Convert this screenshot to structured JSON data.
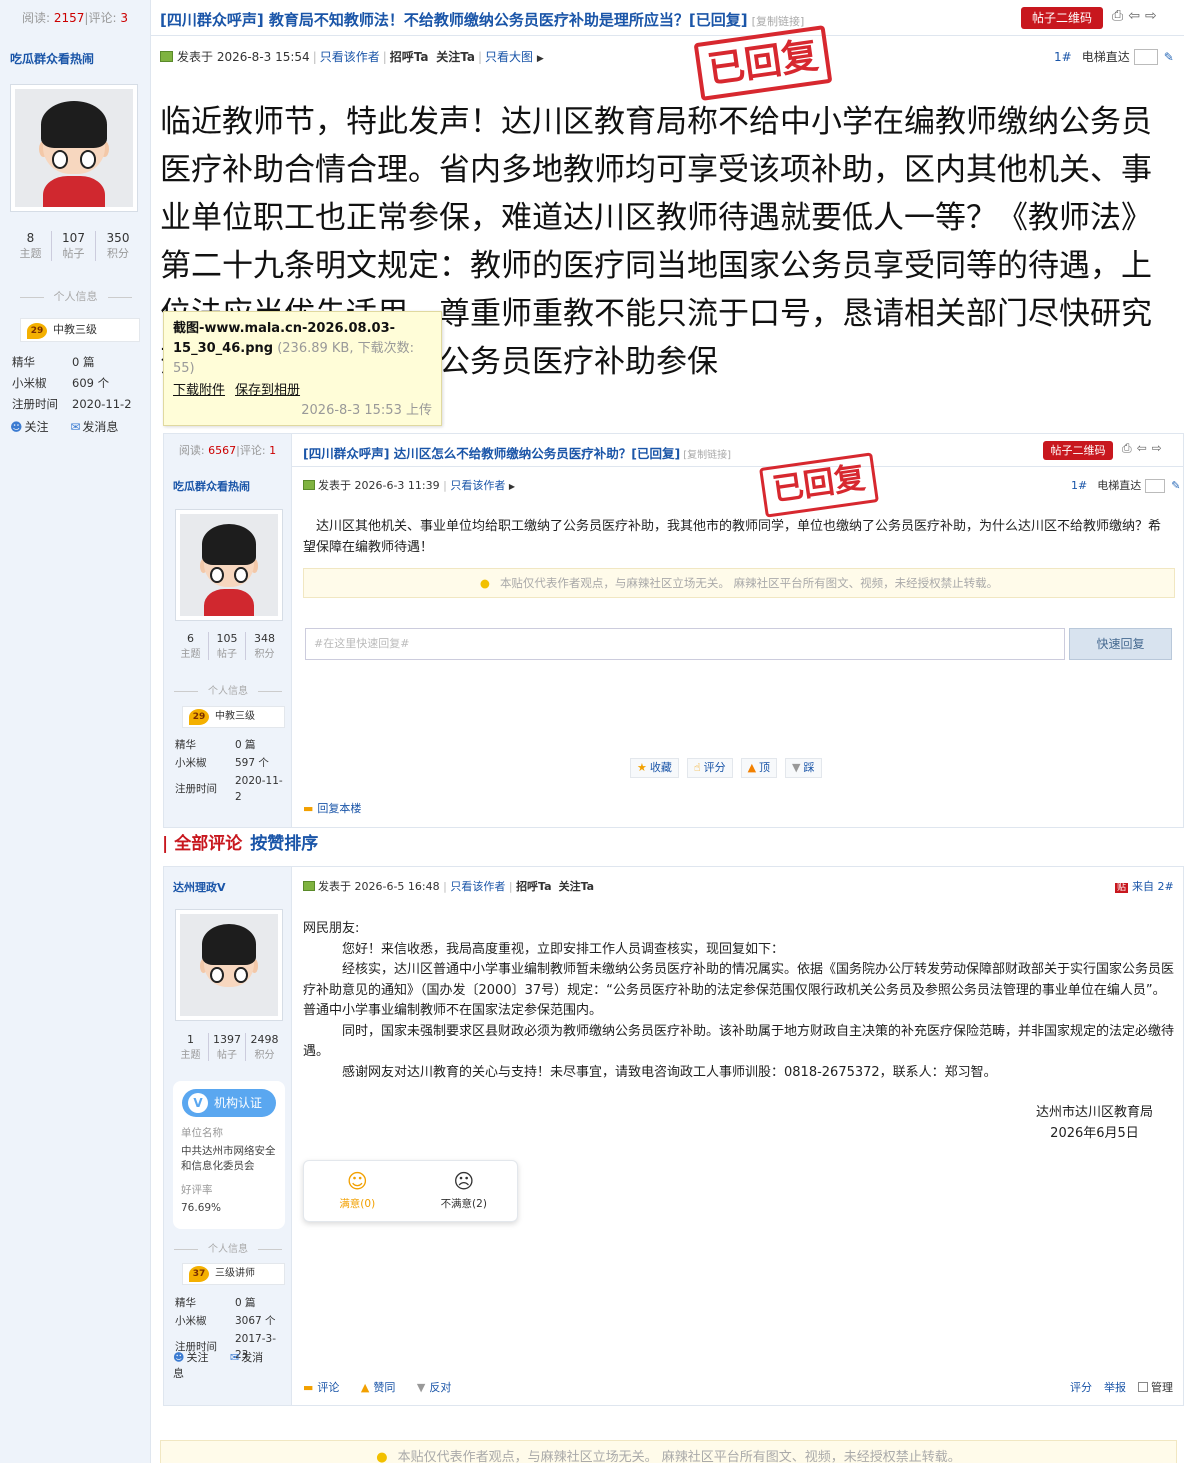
{
  "outer": {
    "header": {
      "views_label": "阅读:",
      "views": "2157",
      "comments_label": "评论:",
      "comments": "3",
      "title": "[四川群众呼声] 教育局不知教师法！不给教师缴纳公务员医疗补助是理所应当？[已回复]",
      "copy_link": "[复制链接]",
      "qr_button": "帖子二维码",
      "icons": [
        "print-icon",
        "prev-icon",
        "next-icon"
      ]
    },
    "user": {
      "name": "吃瓜群众看热闹",
      "stats": [
        {
          "value": "8",
          "label": "主题"
        },
        {
          "value": "107",
          "label": "帖子"
        },
        {
          "value": "350",
          "label": "积分"
        }
      ],
      "section_label": "个人信息",
      "level_num": "29",
      "rank": "中教三级",
      "meta": [
        {
          "k": "精华",
          "v": "0 篇"
        },
        {
          "k": "小米椒",
          "v": "609 个"
        },
        {
          "k": "注册时间",
          "v": "2020-11-2"
        }
      ],
      "follow": "关注",
      "message": "发消息"
    },
    "post": {
      "posted": "发表于 2026-8-3 15:54",
      "only_author": "只看该作者",
      "greet": "招呼Ta",
      "follow": "关注Ta",
      "big_image": "只看大图",
      "floor": "1#",
      "elevator": "电梯直达",
      "stamp": "已回复",
      "content": "临近教师节，特此发声！达川区教育局称不给中小学在编教师缴纳公务员医疗补助合情合理。省内多地教师均可享受该项补助，区内其他机关、事业单位职工也正常参保，难道达川区教师待遇就要低人一等？《教师法》第二十九条明文规定：教师的医疗同当地国家公务员享受同等的待遇，上位法应当优先适用。尊重师重教不能只流于口号，恳请相关部门尽快研究落实公办中小学教师公务员医疗补助参保"
    },
    "tooltip": {
      "filename": "截图-www.mala.cn-2026.08.03-15_30_46.png",
      "meta": "(236.89 KB, 下载次数: 55)",
      "download": "下载附件",
      "save": "保存到相册",
      "time": "2026-8-3 15:53 上传"
    },
    "bottom_notice": "本贴仅代表作者观点，与麻辣社区立场无关。 麻辣社区平台所有图文、视频，未经授权禁止转载。"
  },
  "embedded": {
    "header": {
      "views_label": "阅读:",
      "views": "6567",
      "comments_label": "评论:",
      "comments": "1",
      "title": "[四川群众呼声] 达川区怎么不给教师缴纳公务员医疗补助？[已回复]",
      "copy_link": "[复制链接]",
      "qr_button": "帖子二维码"
    },
    "user": {
      "name": "吃瓜群众看热闹",
      "stats": [
        {
          "value": "6",
          "label": "主题"
        },
        {
          "value": "105",
          "label": "帖子"
        },
        {
          "value": "348",
          "label": "积分"
        }
      ],
      "section_label": "个人信息",
      "level_num": "29",
      "rank": "中教三级",
      "meta": [
        {
          "k": "精华",
          "v": "0 篇"
        },
        {
          "k": "小米椒",
          "v": "597 个"
        },
        {
          "k": "注册时间",
          "v": "2020-11-2"
        }
      ]
    },
    "post": {
      "posted": "发表于 2026-6-3 11:39",
      "only_author": "只看该作者",
      "floor": "1#",
      "elevator": "电梯直达",
      "stamp": "已回复",
      "content": "达川区其他机关、事业单位均给职工缴纳了公务员医疗补助，我其他市的教师同学，单位也缴纳了公务员医疗补助，为什么达川区不给教师缴纳？希望保障在编教师待遇！",
      "notice": "本贴仅代表作者观点，与麻辣社区立场无关。 麻辣社区平台所有图文、视频，未经授权禁止转载。",
      "quick_placeholder": "#在这里快速回复#",
      "quick_button": "快速回复",
      "actions": [
        "收藏",
        "评分",
        "顶",
        "踩"
      ],
      "reply": "回复本楼"
    },
    "comments_header": {
      "all": "全部评论",
      "sort": "按赞排序"
    },
    "comment": {
      "user": {
        "name": "达州理政V",
        "stats": [
          {
            "value": "1",
            "label": "主题"
          },
          {
            "value": "1397",
            "label": "帖子"
          },
          {
            "value": "2498",
            "label": "积分"
          }
        ],
        "verify": "机构认证",
        "unit_label": "单位名称",
        "unit": "中共达州市网络安全和信息化委员会",
        "rate_label": "好评率",
        "rate": "76.69%",
        "section_label": "个人信息",
        "level_num": "37",
        "rank": "三级讲师",
        "meta": [
          {
            "k": "精华",
            "v": "0 篇"
          },
          {
            "k": "小米椒",
            "v": "3067 个"
          },
          {
            "k": "注册时间",
            "v": "2017-3-23"
          }
        ],
        "follow": "关注",
        "message": "发消息"
      },
      "posted": "发表于 2026-6-5 16:48",
      "only_author": "只看该作者",
      "greet": "招呼Ta",
      "follow": "关注Ta",
      "from": "来自 2#",
      "greeting": "网民朋友:",
      "paragraphs": [
        "您好！来信收悉，我局高度重视，立即安排工作人员调查核实，现回复如下：",
        "经核实，达川区普通中小学事业编制教师暂未缴纳公务员医疗补助的情况属实。依据《国务院办公厅转发劳动保障部财政部关于实行国家公务员医疗补助意见的通知》（国办发〔2000〕37号）规定：“公务员医疗补助的法定参保范围仅限行政机关公务员及参照公务员法管理的事业单位在编人员”。普通中小学事业编制教师不在国家法定参保范围内。",
        "同时，国家未强制要求区县财政必须为教师缴纳公务员医疗补助。该补助属于地方财政自主决策的补充医疗保险范畴，并非国家规定的法定必缴待遇。",
        "感谢网友对达川教育的关心与支持！未尽事宜，请致电咨询政工人事师训股：0818-2675372，联系人：郑习智。"
      ],
      "sign_org": "达州市达川区教育局",
      "sign_date": "2026年6月5日",
      "satisfied": "满意(0)",
      "unsatisfied": "不满意(2)",
      "footer_left": [
        "评论",
        "赞同",
        "反对"
      ],
      "footer_right": [
        "评分",
        "举报",
        "管理"
      ]
    }
  },
  "colors": {
    "link_blue": "#1a55a8",
    "brand_red": "#c8171e",
    "sidebar_bg": "#eef3fa"
  }
}
